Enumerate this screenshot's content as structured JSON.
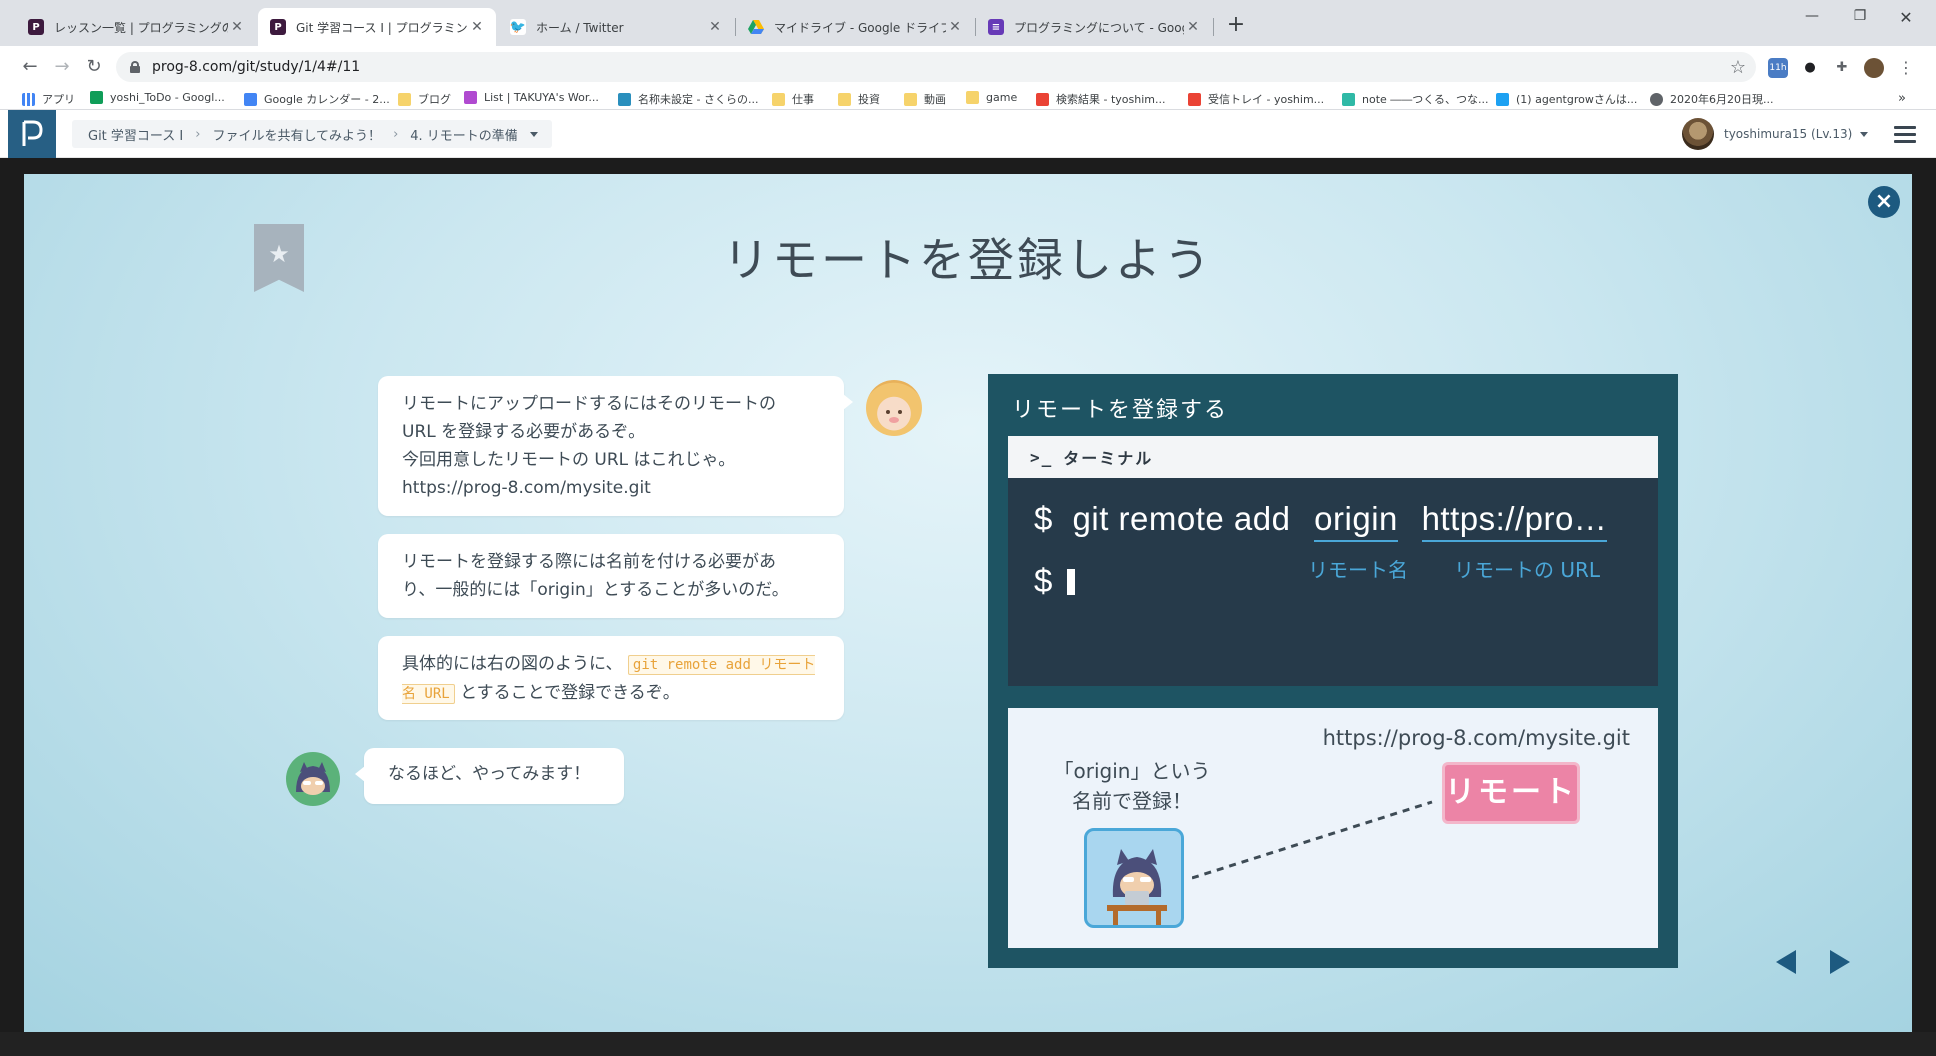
{
  "browser": {
    "tabs": [
      {
        "title": "レッスン一覧 | プログラミングの入門な",
        "favicon_color": "#3d1a3e",
        "active": false
      },
      {
        "title": "Git 学習コース I | プログラミングの入門",
        "favicon_color": "#3d1a3e",
        "active": true
      },
      {
        "title": "ホーム / Twitter",
        "favicon_color": "#1da1f2",
        "active": false
      },
      {
        "title": "マイドライブ - Google ドライブ",
        "favicon_color": "#fbbc04",
        "active": false
      },
      {
        "title": "プログラミングについて - Google フォー",
        "favicon_color": "#673ab7",
        "active": false
      }
    ],
    "url": "prog-8.com/git/study/1/4#/11",
    "bookmarks": [
      "アプリ",
      "yoshi_ToDo - Googl...",
      "Google カレンダー - 2...",
      "ブログ",
      "List | TAKUYA's Wor...",
      "名称未設定 - さくらの...",
      "仕事",
      "投資",
      "動画",
      "game",
      "検索結果 - tyoshim...",
      "受信トレイ - yoshim...",
      "note ――つくる、つな...",
      "(1) agentgrowさんは...",
      "2020年6月20日現..."
    ],
    "bookmarks_more": "»"
  },
  "header": {
    "breadcrumbs": [
      "Git 学習コース I",
      "ファイルを共有してみよう！",
      "4. リモートの準備"
    ],
    "user_label": "tyoshimura15 (Lv.13)"
  },
  "slide": {
    "title": "リモートを登録しよう",
    "bubble1_lines": [
      "リモートにアップロードするにはそのリモートの",
      "URL を登録する必要があるぞ。",
      "今回用意したリモートの URL はこれじゃ。",
      "https://prog-8.com/mysite.git"
    ],
    "bubble2_lines": [
      "リモートを登録する際には名前を付ける必要があ",
      "り、一般的には「origin」とすることが多いのだ。"
    ],
    "bubble3_prefix": "具体的には右の図のように、",
    "bubble3_code": "git remote add リモート名 URL",
    "bubble3_suffix": "とすることで登録できるぞ。",
    "reply": "なるほど、やってみます！"
  },
  "panel": {
    "title": "リモートを登録する",
    "terminal_title": "ターミナル",
    "prompt": "$",
    "cmd": "git remote add",
    "cmd_name": "origin",
    "cmd_url": "https://pro…",
    "note_name": "リモート名",
    "note_url": "リモートの URL",
    "remote_url": "https://prog-8.com/mysite.git",
    "remote_badge": "リモート",
    "register_line1": "「origin」という",
    "register_line2": "名前で登録！"
  },
  "colors": {
    "accent": "#1d5a80",
    "panel_bg": "#1e5463",
    "terminal_bg": "#263a4a",
    "code_orange": "#e8a33a",
    "remote_pink": "#ec84a6",
    "note_blue": "#4aa7d8"
  }
}
